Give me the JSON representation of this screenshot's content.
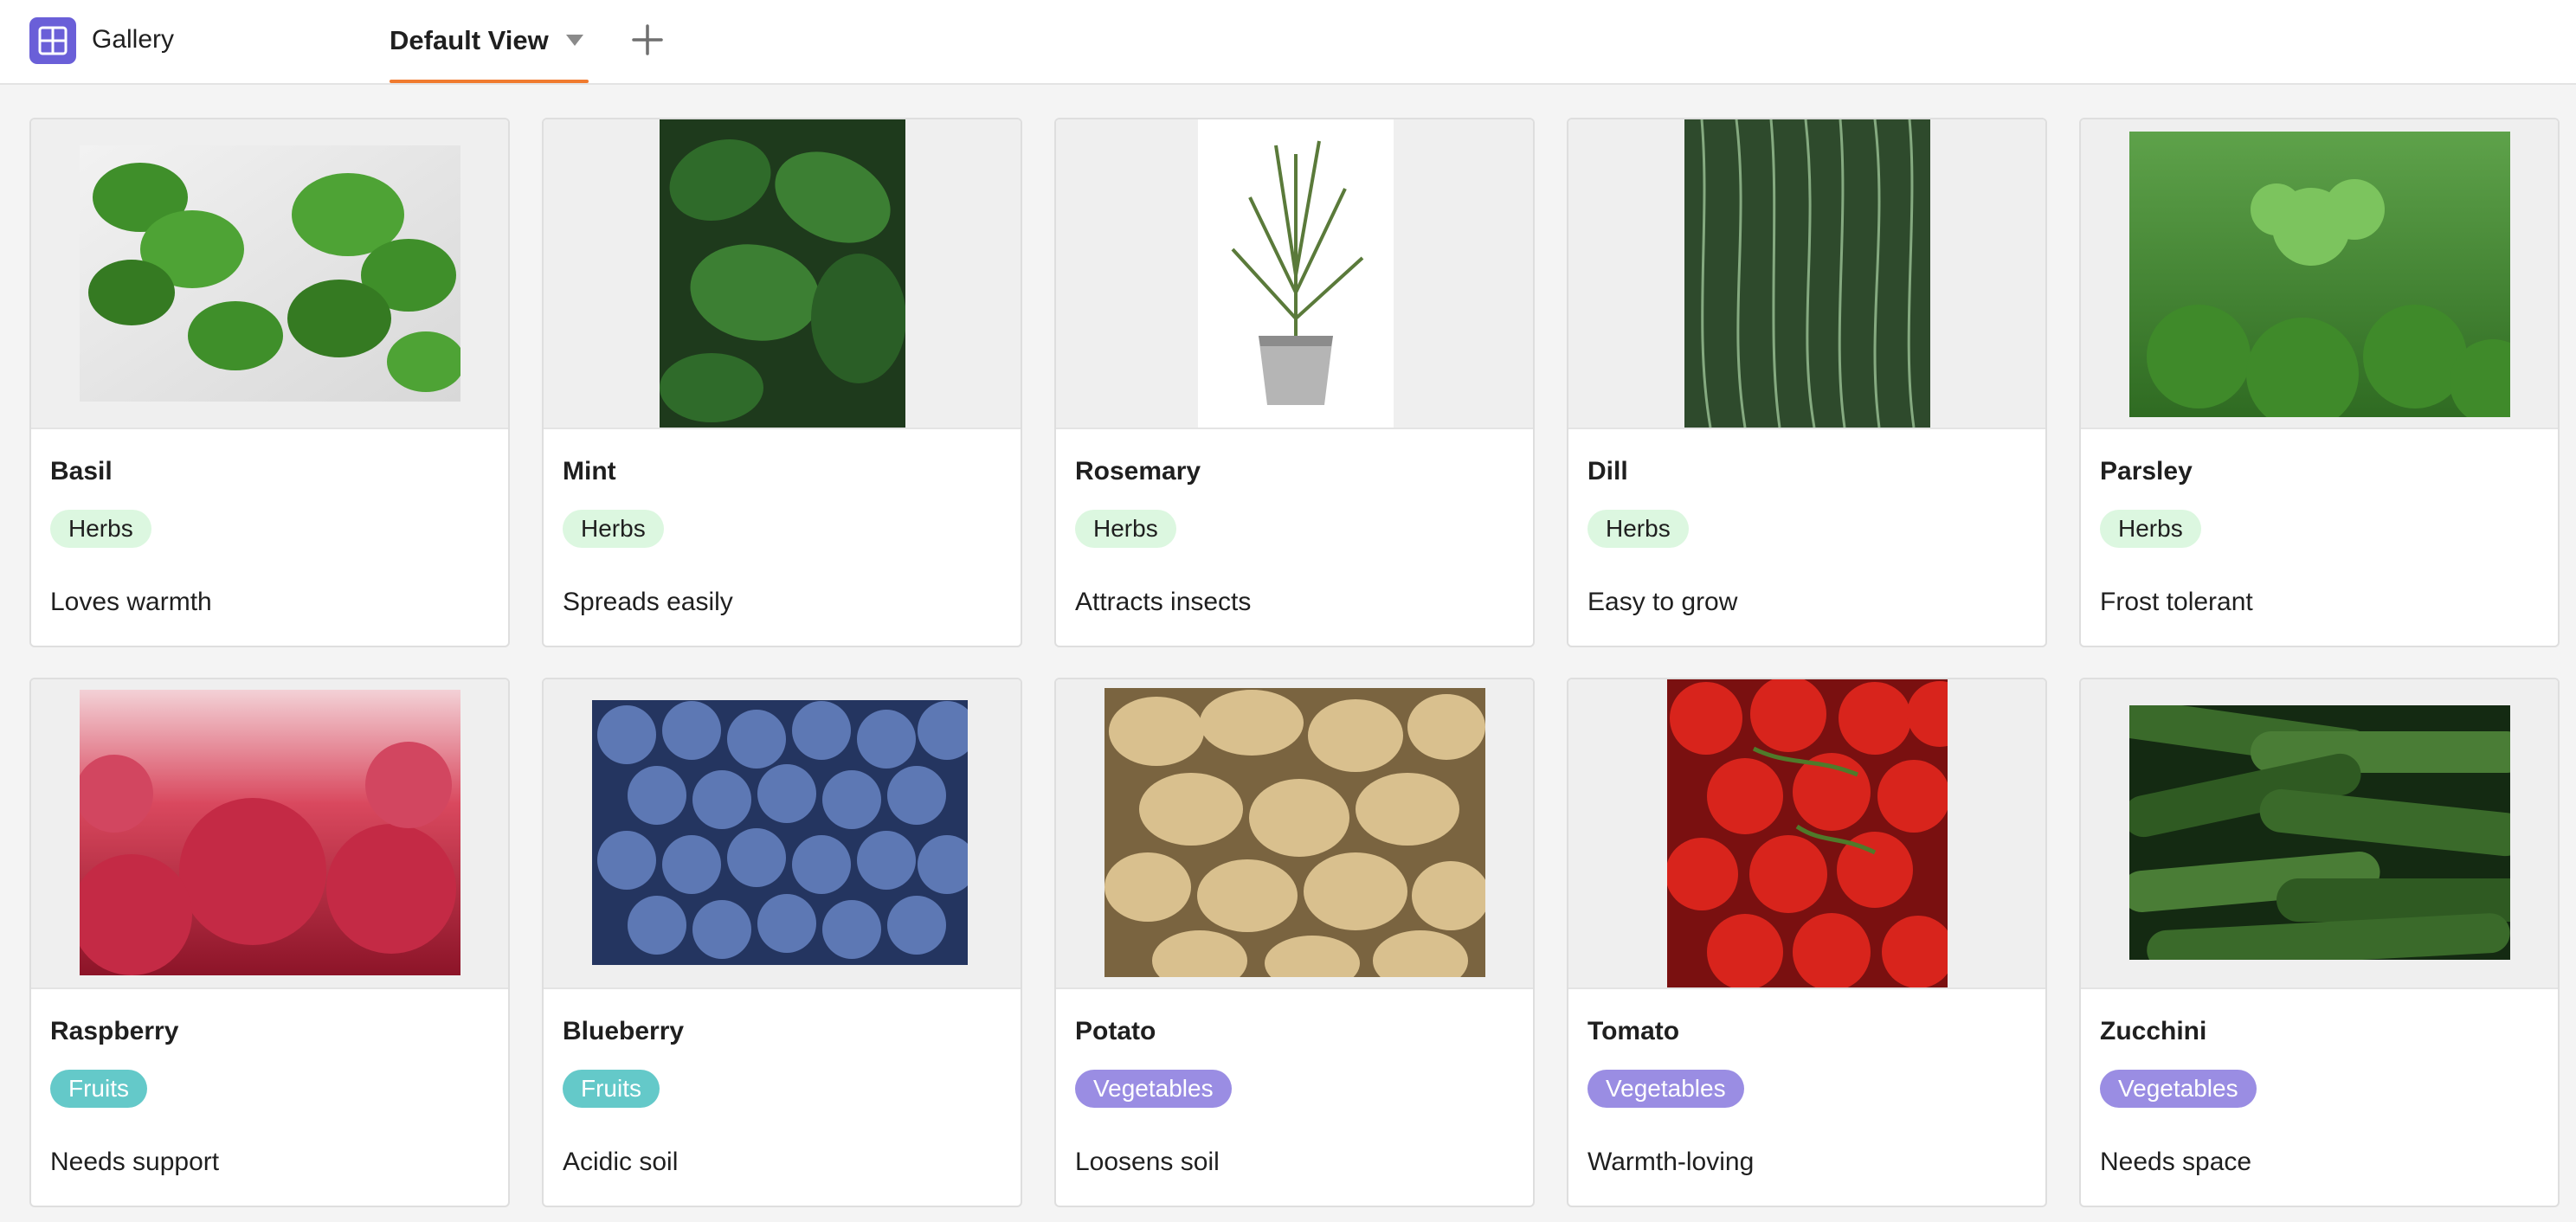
{
  "app": {
    "title": "Gallery",
    "icon": "grid-icon",
    "accent": "#6a5fd8"
  },
  "views": {
    "active_label": "Default View",
    "active_indicator_color": "#f07a2e",
    "add_icon": "plus-icon"
  },
  "category_colors": {
    "Herbs": "#dcf7e0",
    "Fruits": "#64c9c9",
    "Vegetables": "#9a8de3"
  },
  "cards": [
    {
      "name": "Basil",
      "category": "Herbs",
      "note": "Loves warmth"
    },
    {
      "name": "Mint",
      "category": "Herbs",
      "note": "Spreads easily"
    },
    {
      "name": "Rosemary",
      "category": "Herbs",
      "note": "Attracts insects"
    },
    {
      "name": "Dill",
      "category": "Herbs",
      "note": "Easy to grow"
    },
    {
      "name": "Parsley",
      "category": "Herbs",
      "note": "Frost tolerant"
    },
    {
      "name": "Raspberry",
      "category": "Fruits",
      "note": "Needs support"
    },
    {
      "name": "Blueberry",
      "category": "Fruits",
      "note": "Acidic soil"
    },
    {
      "name": "Potato",
      "category": "Vegetables",
      "note": "Loosens soil"
    },
    {
      "name": "Tomato",
      "category": "Vegetables",
      "note": "Warmth-loving"
    },
    {
      "name": "Zucchini",
      "category": "Vegetables",
      "note": "Needs space"
    }
  ]
}
